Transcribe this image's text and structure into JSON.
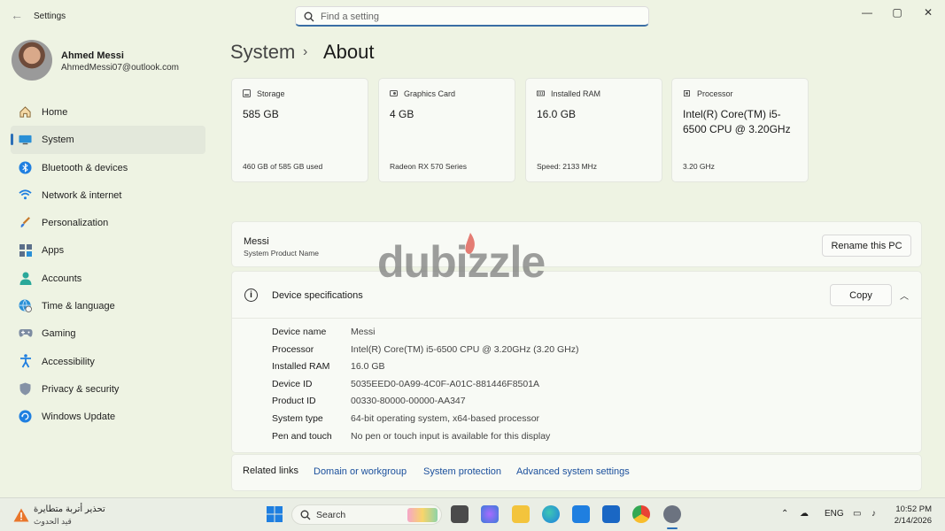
{
  "window": {
    "title": "Settings"
  },
  "search": {
    "placeholder": "Find a setting"
  },
  "profile": {
    "name": "Ahmed Messi",
    "email": "AhmedMessi07@outlook.com"
  },
  "sidebar": {
    "items": [
      {
        "label": "Home",
        "icon": "home-icon"
      },
      {
        "label": "System",
        "icon": "system-icon",
        "active": true
      },
      {
        "label": "Bluetooth & devices",
        "icon": "bluetooth-icon"
      },
      {
        "label": "Network & internet",
        "icon": "wifi-icon"
      },
      {
        "label": "Personalization",
        "icon": "brush-icon"
      },
      {
        "label": "Apps",
        "icon": "apps-icon"
      },
      {
        "label": "Accounts",
        "icon": "person-icon"
      },
      {
        "label": "Time & language",
        "icon": "globe-clock-icon"
      },
      {
        "label": "Gaming",
        "icon": "gamepad-icon"
      },
      {
        "label": "Accessibility",
        "icon": "accessibility-icon"
      },
      {
        "label": "Privacy & security",
        "icon": "shield-icon"
      },
      {
        "label": "Windows Update",
        "icon": "update-icon"
      }
    ]
  },
  "breadcrumb": {
    "parent": "System",
    "separator": "›",
    "current": "About"
  },
  "cards": [
    {
      "label": "Storage",
      "value": "585 GB",
      "sub": "460 GB of 585 GB used",
      "icon": "storage-icon"
    },
    {
      "label": "Graphics Card",
      "value": "4 GB",
      "sub": "Radeon RX 570 Series",
      "icon": "graphics-card-icon"
    },
    {
      "label": "Installed RAM",
      "value": "16.0 GB",
      "sub": "Speed: 2133 MHz",
      "icon": "ram-icon"
    },
    {
      "label": "Processor",
      "value": "Intel(R) Core(TM) i5-6500 CPU @ 3.20GHz",
      "sub": "3.20 GHz",
      "icon": "processor-icon"
    }
  ],
  "pc": {
    "name": "Messi",
    "sub": "System Product Name",
    "rename_label": "Rename this PC"
  },
  "specs": {
    "title": "Device specifications",
    "copy_label": "Copy",
    "rows": [
      {
        "key": "Device name",
        "value": "Messi"
      },
      {
        "key": "Processor",
        "value": "Intel(R) Core(TM) i5-6500 CPU @ 3.20GHz (3.20 GHz)"
      },
      {
        "key": "Installed RAM",
        "value": "16.0 GB"
      },
      {
        "key": "Device ID",
        "value": "5035EED0-0A99-4C0F-A01C-881446F8501A"
      },
      {
        "key": "Product ID",
        "value": "00330-80000-00000-AA347"
      },
      {
        "key": "System type",
        "value": "64-bit operating system, x64-based processor"
      },
      {
        "key": "Pen and touch",
        "value": "No pen or touch input is available for this display"
      }
    ]
  },
  "related": {
    "label": "Related links",
    "links": [
      "Domain or workgroup",
      "System protection",
      "Advanced system settings"
    ]
  },
  "watermark": {
    "text": "dubizzle"
  },
  "taskbar": {
    "alert_title": "تحذير أتربة متطايرة",
    "alert_sub": "قيد الحدوث",
    "search_label": "Search",
    "language": "ENG",
    "time": "10:52 PM",
    "date": "2/14/2026"
  },
  "colors": {
    "accent": "#2c6fb7",
    "background": "#eef3e3",
    "link": "#1a4f9c"
  }
}
